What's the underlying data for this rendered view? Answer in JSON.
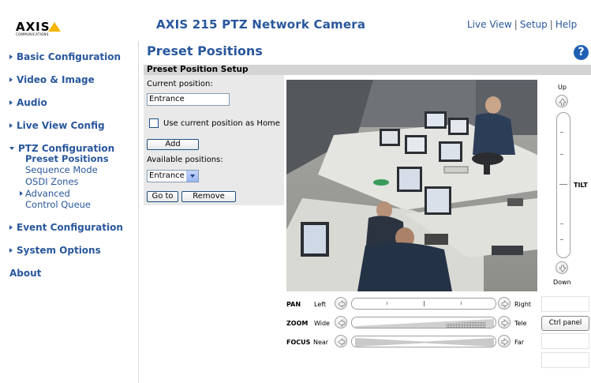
{
  "header": {
    "logo_text": "AXIS",
    "logo_sub": "COMMUNICATIONS",
    "product_title": "AXIS 215 PTZ Network Camera",
    "links": [
      "Live View",
      "Setup",
      "Help"
    ],
    "separator": "|"
  },
  "sidebar": {
    "items": [
      {
        "label": "Basic Configuration"
      },
      {
        "label": "Video & Image"
      },
      {
        "label": "Audio"
      },
      {
        "label": "Live View Config"
      },
      {
        "label": "PTZ Configuration"
      },
      {
        "label": "Event Configuration"
      },
      {
        "label": "System Options"
      },
      {
        "label": "About"
      }
    ],
    "ptz_subitems": [
      {
        "label": "Preset Positions"
      },
      {
        "label": "Sequence Mode"
      },
      {
        "label": "OSDI Zones"
      },
      {
        "label": "Advanced"
      },
      {
        "label": "Control Queue"
      }
    ]
  },
  "page": {
    "title": "Preset Positions",
    "help_glyph": "?",
    "section_title": "Preset Position Setup"
  },
  "form": {
    "current_position_label": "Current position:",
    "current_position_value": "Entrance",
    "use_as_home_label": "Use current position as Home",
    "add_label": "Add",
    "available_label": "Available positions:",
    "selected_position": "Entrance",
    "goto_label": "Go to",
    "remove_label": "Remove"
  },
  "ptz": {
    "tilt_up": "Up",
    "tilt_down": "Down",
    "tilt_label": "TILT",
    "pan_label": "PAN",
    "pan_left": "Left",
    "pan_right": "Right",
    "zoom_label": "ZOOM",
    "zoom_wide": "Wide",
    "zoom_tele": "Tele",
    "focus_label": "FOCUS",
    "focus_near": "Near",
    "focus_far": "Far",
    "ctrl_panel_label": "Ctrl panel"
  },
  "colors": {
    "brand_blue": "#29579d",
    "section_gray": "#d4d4d4",
    "panel_gray": "#e9e9e9",
    "logo_yellow": "#f5b400"
  }
}
